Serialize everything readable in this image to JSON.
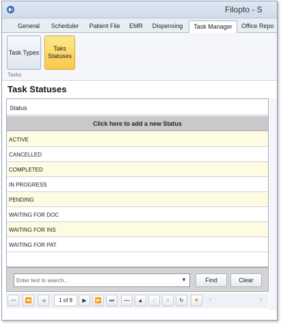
{
  "window": {
    "title": "Filopto - S"
  },
  "tabs": [
    {
      "label": "General"
    },
    {
      "label": "Scheduler"
    },
    {
      "label": "Patient File"
    },
    {
      "label": "EMR"
    },
    {
      "label": "Dispensing"
    },
    {
      "label": "Task Manager"
    },
    {
      "label": "Office Repo"
    }
  ],
  "ribbon": {
    "buttons": [
      {
        "label": "Task Types"
      },
      {
        "label": "Taks Statuses"
      }
    ],
    "group_label": "Tasks"
  },
  "page": {
    "heading": "Task Statuses"
  },
  "grid": {
    "column_header": "Status",
    "add_row_text": "Click here to add a new Status",
    "rows": [
      "ACTIVE",
      "CANCELLED",
      "COMPLETED",
      "IN PROGRESS",
      "PENDING",
      "WAITING FOR DOC",
      "WAITING FOR INS",
      "WAITING FOR PAT"
    ]
  },
  "search": {
    "placeholder": "Enter text to search...",
    "find_label": "Find",
    "clear_label": "Clear"
  },
  "navigator": {
    "page_info": "1 of 8",
    "colors": {
      "delete": "#cc2222",
      "filter": "#e58a1f"
    }
  },
  "colors": {
    "selected_ribbon": "#f9c84a",
    "alt_row": "#fdfbe1",
    "add_row": "#c9c9c9"
  }
}
